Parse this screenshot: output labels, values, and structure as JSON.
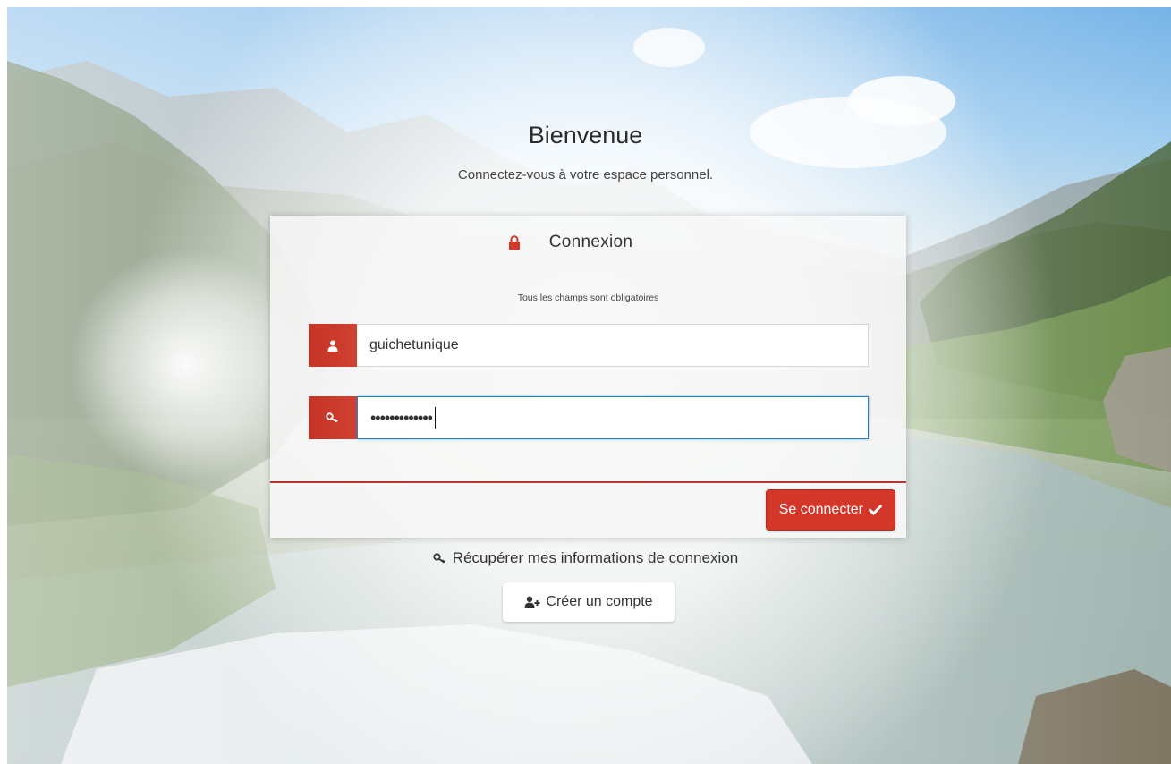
{
  "welcome": {
    "title": "Bienvenue",
    "subtitle": "Connectez-vous à votre espace personnel."
  },
  "login_card": {
    "title": "Connexion",
    "title_icon": "lock-icon",
    "required_note": "Tous les champs sont obligatoires",
    "username": {
      "icon": "user-icon",
      "value": "guichetunique"
    },
    "password": {
      "icon": "key-icon",
      "masked_value": "•••••••••••••"
    },
    "submit": {
      "label": "Se connecter",
      "icon": "check-icon"
    }
  },
  "recover": {
    "icon": "key-icon",
    "label": "Récupérer mes informations de connexion"
  },
  "create_account": {
    "icon": "user-plus-icon",
    "label": "Créer un compte"
  },
  "colors": {
    "accent": "#d2372a",
    "accent_dark": "#b02a1f",
    "focus_border": "#2e7fb6"
  }
}
